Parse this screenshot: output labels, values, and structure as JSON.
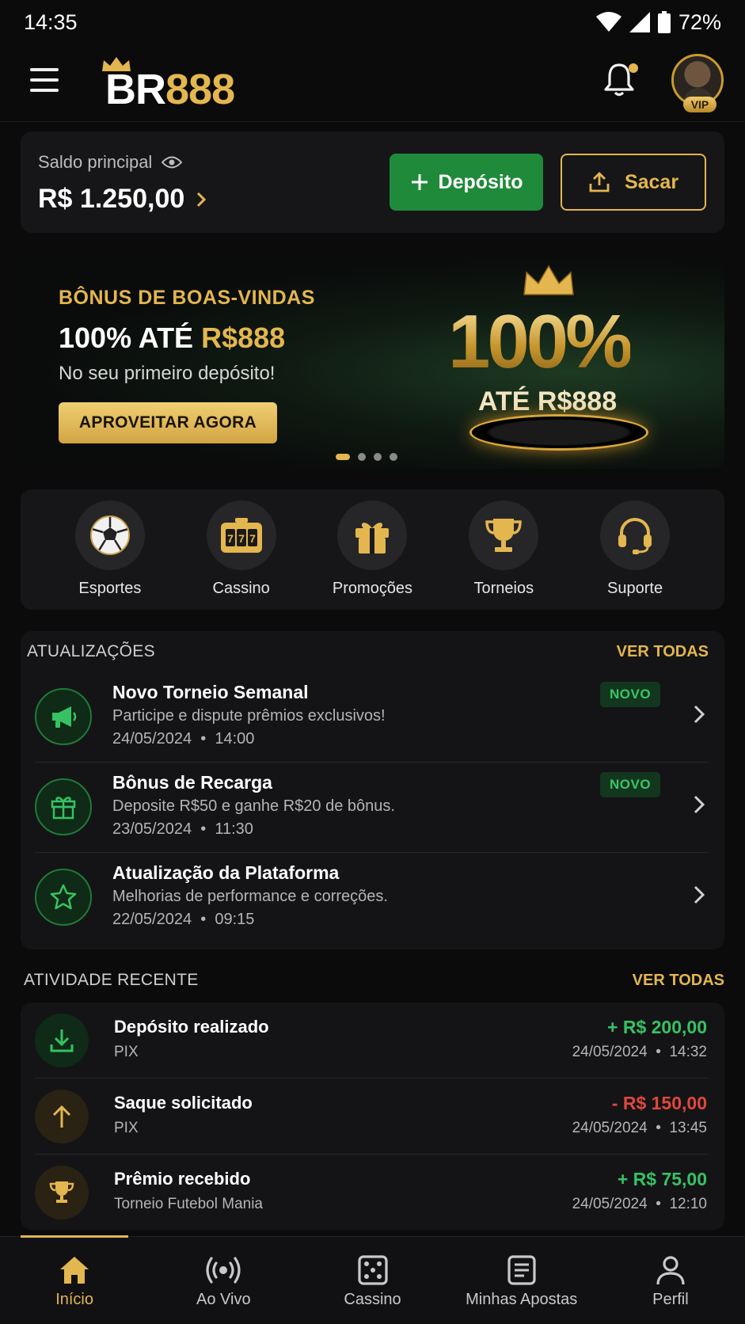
{
  "status_bar": {
    "time": "14:35",
    "battery": "72%"
  },
  "header": {
    "logo_text_white": "BR",
    "logo_text_gold": "888",
    "vip_label": "VIP"
  },
  "balance": {
    "label": "Saldo principal",
    "value": "R$ 1.250,00",
    "deposit_label": "Depósito",
    "withdraw_label": "Sacar"
  },
  "banner": {
    "kicker": "BÔNUS DE BOAS-VINDAS",
    "title_white": "100% ATÉ ",
    "title_gold": "R$888",
    "subtitle": "No seu primeiro depósito!",
    "cta": "APROVEITAR AGORA",
    "art_big": "100%",
    "art_sub": "ATÉ R$888",
    "slides_total": 4,
    "slide_active": 1
  },
  "categories": [
    {
      "label": "Esportes",
      "icon": "soccer-ball-icon"
    },
    {
      "label": "Cassino",
      "icon": "slot-machine-icon"
    },
    {
      "label": "Promoções",
      "icon": "gift-icon"
    },
    {
      "label": "Torneios",
      "icon": "trophy-icon"
    },
    {
      "label": "Suporte",
      "icon": "headset-icon"
    }
  ],
  "updates": {
    "title": "ATUALIZAÇÕES",
    "see_all": "VER TODAS",
    "items": [
      {
        "title": "Novo Torneio Semanal",
        "desc": "Participe e dispute prêmios exclusivos!",
        "date": "24/05/2024",
        "time": "14:00",
        "badge": "NOVO",
        "icon": "megaphone-icon"
      },
      {
        "title": "Bônus de Recarga",
        "desc": "Deposite R$50 e ganhe R$20 de bônus.",
        "date": "23/05/2024",
        "time": "11:30",
        "badge": "NOVO",
        "icon": "gift-icon"
      },
      {
        "title": "Atualização da Plataforma",
        "desc": "Melhorias de performance e correções.",
        "date": "22/05/2024",
        "time": "09:15",
        "badge": "",
        "icon": "star-icon"
      }
    ]
  },
  "activity": {
    "title": "ATIVIDADE RECENTE",
    "see_all": "VER TODAS",
    "items": [
      {
        "title": "Depósito realizado",
        "sub": "PIX",
        "amount": "+ R$ 200,00",
        "date": "24/05/2024",
        "time": "14:32",
        "type": "positive",
        "icon": "download-icon"
      },
      {
        "title": "Saque solicitado",
        "sub": "PIX",
        "amount": "- R$ 150,00",
        "date": "24/05/2024",
        "time": "13:45",
        "type": "negative",
        "icon": "arrow-up-icon"
      },
      {
        "title": "Prêmio recebido",
        "sub": "Torneio Futebol Mania",
        "amount": "+ R$ 75,00",
        "date": "24/05/2024",
        "time": "12:10",
        "type": "positive",
        "icon": "trophy-icon"
      }
    ]
  },
  "bottom_nav": [
    {
      "label": "Início",
      "icon": "home-icon",
      "active": true
    },
    {
      "label": "Ao Vivo",
      "icon": "live-broadcast-icon",
      "active": false
    },
    {
      "label": "Cassino",
      "icon": "dice-icon",
      "active": false
    },
    {
      "label": "Minhas Apostas",
      "icon": "receipt-icon",
      "active": false
    },
    {
      "label": "Perfil",
      "icon": "user-icon",
      "active": false
    }
  ],
  "colors": {
    "gold": "#e3b64f",
    "green": "#1f8a3a",
    "positive": "#36c263",
    "negative": "#e0473c",
    "background": "#0b0b0c"
  }
}
